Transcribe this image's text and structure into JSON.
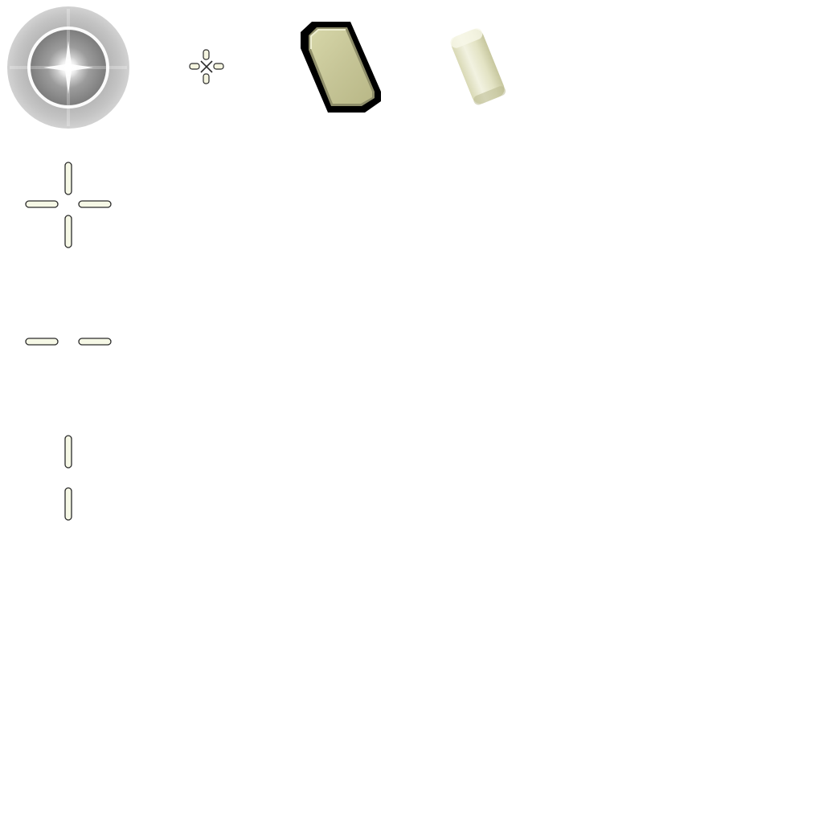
{
  "sheet": {
    "background_color": "#ffffff",
    "sprites": [
      {
        "id": "radial-glow",
        "icon": "radial-glow-flare-icon",
        "colors": [
          "#8f8f8f",
          "#bdbdbd",
          "#ffffff"
        ]
      },
      {
        "id": "mini-crosshair",
        "icon": "small-crosshair-icon",
        "colors": [
          "#2b2b2b",
          "#f5f5e0"
        ]
      },
      {
        "id": "dark-frame-panel",
        "icon": "tilted-panel-dark-frame-icon",
        "colors": [
          "#000000",
          "#c6c597",
          "#e2e1b8"
        ]
      },
      {
        "id": "cream-capsule",
        "icon": "tilted-cream-capsule-icon",
        "colors": [
          "#e6e6c6",
          "#f7f7e8",
          "#d3d3ae"
        ]
      },
      {
        "id": "crosshair-full",
        "icon": "crosshair-four-arms-icon",
        "colors": [
          "#2a2a2a",
          "#f6f8e6"
        ]
      },
      {
        "id": "crosshair-horizontal",
        "icon": "crosshair-horizontal-arms-icon",
        "colors": [
          "#2a2a2a",
          "#f6f8e6"
        ]
      },
      {
        "id": "crosshair-vertical",
        "icon": "crosshair-vertical-arms-icon",
        "colors": [
          "#2a2a2a",
          "#f6f8e6"
        ]
      }
    ]
  }
}
